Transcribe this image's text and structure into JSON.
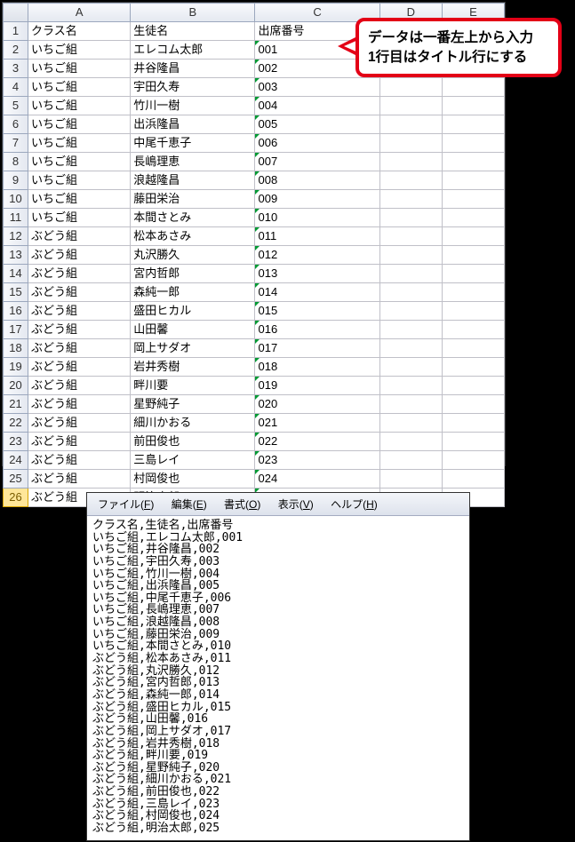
{
  "spreadsheet": {
    "colHeaders": [
      "A",
      "B",
      "C",
      "D",
      "E"
    ],
    "rowCount": 26,
    "selectedRow": 26,
    "headerRow": [
      "クラス名",
      "生徒名",
      "出席番号"
    ],
    "rows": [
      {
        "a": "いちご組",
        "b": "エレコム太郎",
        "c": "001"
      },
      {
        "a": "いちご組",
        "b": "井谷隆昌",
        "c": "002"
      },
      {
        "a": "いちご組",
        "b": "宇田久寿",
        "c": "003"
      },
      {
        "a": "いちご組",
        "b": "竹川一樹",
        "c": "004"
      },
      {
        "a": "いちご組",
        "b": "出浜隆昌",
        "c": "005"
      },
      {
        "a": "いちご組",
        "b": "中尾千恵子",
        "c": "006"
      },
      {
        "a": "いちご組",
        "b": "長嶋理恵",
        "c": "007"
      },
      {
        "a": "いちご組",
        "b": "浪越隆昌",
        "c": "008"
      },
      {
        "a": "いちご組",
        "b": "藤田栄治",
        "c": "009"
      },
      {
        "a": "いちご組",
        "b": "本間さとみ",
        "c": "010"
      },
      {
        "a": "ぶどう組",
        "b": "松本あさみ",
        "c": "011"
      },
      {
        "a": "ぶどう組",
        "b": "丸沢勝久",
        "c": "012"
      },
      {
        "a": "ぶどう組",
        "b": "宮内哲郎",
        "c": "013"
      },
      {
        "a": "ぶどう組",
        "b": "森純一郎",
        "c": "014"
      },
      {
        "a": "ぶどう組",
        "b": "盛田ヒカル",
        "c": "015"
      },
      {
        "a": "ぶどう組",
        "b": "山田馨",
        "c": "016"
      },
      {
        "a": "ぶどう組",
        "b": "岡上サダオ",
        "c": "017"
      },
      {
        "a": "ぶどう組",
        "b": "岩井秀樹",
        "c": "018"
      },
      {
        "a": "ぶどう組",
        "b": "畔川要",
        "c": "019"
      },
      {
        "a": "ぶどう組",
        "b": "星野純子",
        "c": "020"
      },
      {
        "a": "ぶどう組",
        "b": "細川かおる",
        "c": "021"
      },
      {
        "a": "ぶどう組",
        "b": "前田俊也",
        "c": "022"
      },
      {
        "a": "ぶどう組",
        "b": "三島レイ",
        "c": "023"
      },
      {
        "a": "ぶどう組",
        "b": "村岡俊也",
        "c": "024"
      },
      {
        "a": "ぶどう組",
        "b": "明治太郎",
        "c": "025"
      }
    ]
  },
  "callout": {
    "line1": "データは一番左上から入力",
    "line2": "1行目はタイトル行にする"
  },
  "editor": {
    "menu": {
      "file": "ファイル(F)",
      "edit": "編集(E)",
      "format": "書式(O)",
      "view": "表示(V)",
      "help": "ヘルプ(H)"
    },
    "lines": [
      "クラス名,生徒名,出席番号",
      "いちご組,エレコム太郎,001",
      "いちご組,井谷隆昌,002",
      "いちご組,宇田久寿,003",
      "いちご組,竹川一樹,004",
      "いちご組,出浜隆昌,005",
      "いちご組,中尾千恵子,006",
      "いちご組,長嶋理恵,007",
      "いちご組,浪越隆昌,008",
      "いちご組,藤田栄治,009",
      "いちご組,本間さとみ,010",
      "ぶどう組,松本あさみ,011",
      "ぶどう組,丸沢勝久,012",
      "ぶどう組,宮内哲郎,013",
      "ぶどう組,森純一郎,014",
      "ぶどう組,盛田ヒカル,015",
      "ぶどう組,山田馨,016",
      "ぶどう組,岡上サダオ,017",
      "ぶどう組,岩井秀樹,018",
      "ぶどう組,畔川要,019",
      "ぶどう組,星野純子,020",
      "ぶどう組,細川かおる,021",
      "ぶどう組,前田俊也,022",
      "ぶどう組,三島レイ,023",
      "ぶどう組,村岡俊也,024",
      "ぶどう組,明治太郎,025"
    ]
  }
}
